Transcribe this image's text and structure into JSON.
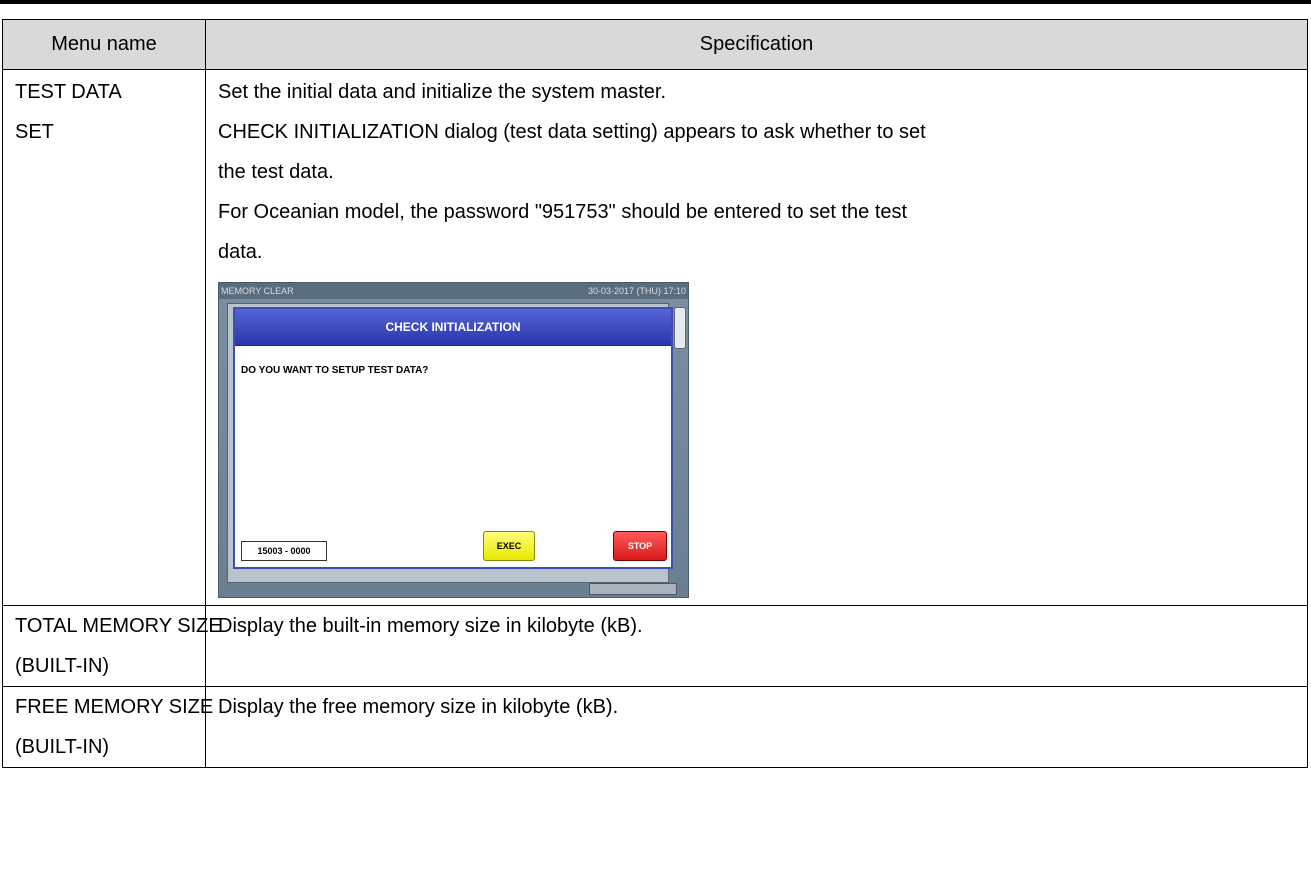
{
  "table": {
    "headers": [
      "Menu name",
      "Specification"
    ],
    "rows": [
      {
        "name_lines": [
          "TEST DATA",
          "SET"
        ],
        "spec_lines": [
          "Set the initial data and initialize the system master.",
          "CHECK INITIALIZATION dialog (test data setting) appears to ask whether to set",
          "the test data.",
          "For Oceanian model, the password \"951753\" should be entered to set the test",
          "data."
        ]
      },
      {
        "name_lines": [
          "TOTAL MEMORY SIZE",
          "(BUILT-IN)"
        ],
        "spec_lines": [
          "Display the built-in memory size in kilobyte (kB)."
        ]
      },
      {
        "name_lines": [
          "FREE MEMORY SIZE",
          "(BUILT-IN)"
        ],
        "spec_lines": [
          "Display the free memory size in kilobyte (kB)."
        ]
      }
    ]
  },
  "screenshot": {
    "screen_title": "MEMORY CLEAR",
    "datetime": "30-03-2017 (THU) 17:10",
    "dialog_title": "CHECK INITIALIZATION",
    "message": "DO YOU WANT TO SETUP TEST DATA?",
    "code": "15003 - 0000",
    "exec_label": "EXEC",
    "stop_label": "STOP"
  }
}
